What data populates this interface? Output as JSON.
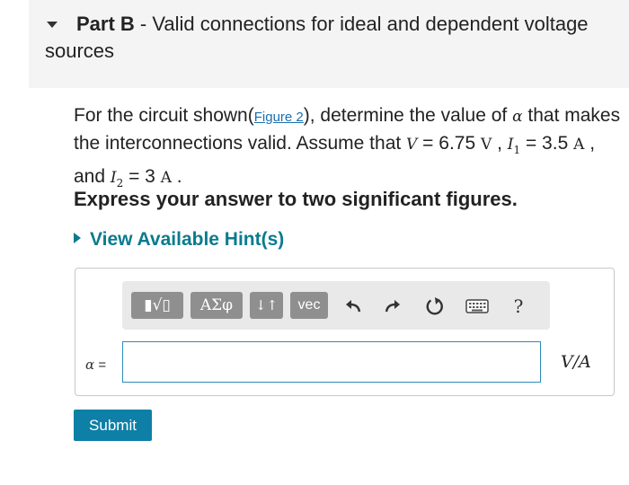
{
  "part": {
    "label": "Part B",
    "separator": "-",
    "title": "Valid connections for ideal and dependent voltage sources"
  },
  "problem": {
    "intro": "For the circuit shown(",
    "figure_link": "Figure 2",
    "mid": "), determine the value of ",
    "alpha_symbol": "α",
    "line1_end": " that makes the interconnections valid. Assume that ",
    "V_symbol": "V",
    "V_eq": " = 6.75 ",
    "V_unit": "V",
    "sep1": " , ",
    "I1_symbol": "I",
    "I1_sub": "1",
    "I1_eq": " = 3.5 ",
    "I1_unit": "A",
    "sep2": " , and ",
    "I2_symbol": "I",
    "I2_sub": "2",
    "I2_eq": " = 3 ",
    "I2_unit": "A",
    "end": " ."
  },
  "instruction": "Express your answer to two significant figures.",
  "hint": "View Available Hint(s)",
  "toolbar": {
    "btn_templates": "▮√▯",
    "btn_greek": "ΑΣφ",
    "btn_sort": "↓↑",
    "btn_vec": "vec",
    "help_label": "?",
    "icons": [
      "undo-icon",
      "redo-icon",
      "reset-icon",
      "keyboard-icon",
      "help-icon"
    ]
  },
  "answer": {
    "variable": "α",
    "equals": "=",
    "value": "",
    "units": "V/A"
  },
  "submit_label": "Submit",
  "colors": {
    "header_bg": "#f4f4f4",
    "hint_teal": "#0b7b8e",
    "link_blue": "#1a6fb0",
    "toolbar_button_gray": "#8f8f8f",
    "input_border": "#2b8bb8",
    "submit_bg": "#0e7fa6"
  }
}
